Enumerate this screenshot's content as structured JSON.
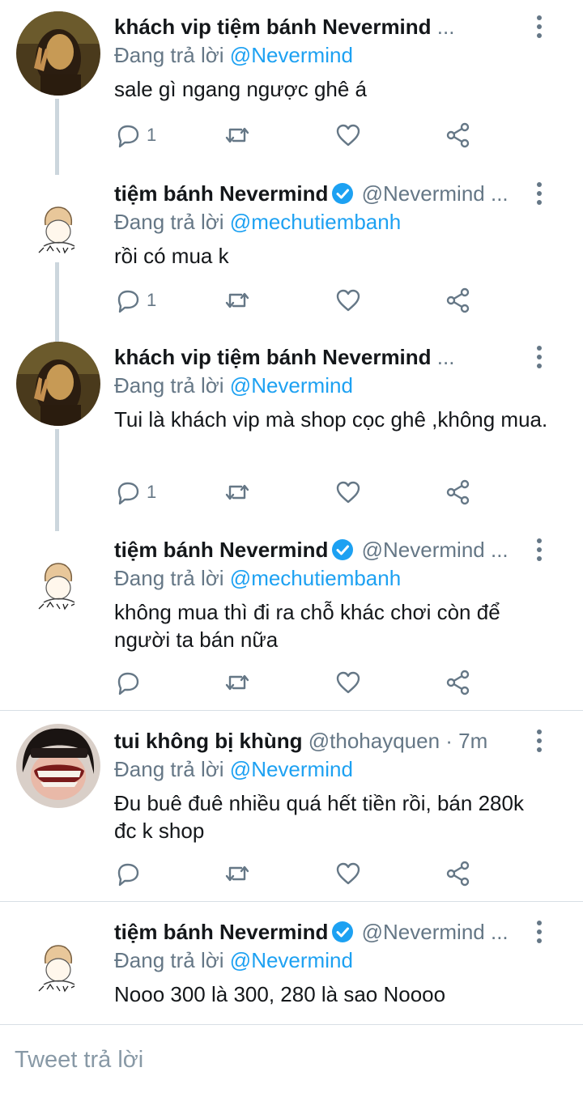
{
  "tweets": [
    {
      "avatar": "mona-lisa-avatar",
      "name": "khách vip tiệm bánh Nevermind",
      "verified": false,
      "handle": "",
      "ellipsis": "...",
      "time": "",
      "reply_prefix": "Đang trả lời",
      "reply_to": "@Nevermind",
      "text": "sale gì ngang ngược ghê á",
      "reply_count": "1"
    },
    {
      "avatar": "nevermind-sketch-avatar",
      "name": "tiệm bánh Nevermind",
      "verified": true,
      "handle": "@Nevermind ...",
      "ellipsis": "",
      "time": "",
      "reply_prefix": "Đang trả lời",
      "reply_to": "@mechutiembanh",
      "text": "rồi có mua k",
      "reply_count": "1"
    },
    {
      "avatar": "mona-lisa-avatar",
      "name": "khách vip tiệm bánh Nevermind",
      "verified": false,
      "handle": "",
      "ellipsis": "...",
      "time": "",
      "reply_prefix": "Đang trả lời",
      "reply_to": "@Nevermind",
      "text": "Tui là khách vip mà shop cọc ghê ,không mua.",
      "reply_count": "1"
    },
    {
      "avatar": "nevermind-sketch-avatar",
      "name": "tiệm bánh Nevermind",
      "verified": true,
      "handle": "@Nevermind ...",
      "ellipsis": "",
      "time": "",
      "reply_prefix": "Đang trả lời",
      "reply_to": "@mechutiembanh",
      "text": "không mua thì đi ra chỗ khác chơi còn để người ta bán nữa",
      "reply_count": ""
    },
    {
      "avatar": "grinning-face-avatar",
      "name": "tui không bị khùng",
      "verified": false,
      "handle": "@thohayquen · 7m",
      "ellipsis": "",
      "time": "",
      "reply_prefix": "Đang trả lời",
      "reply_to": "@Nevermind",
      "text": "Đu buê đuê nhiều quá hết tiền rồi, bán 280k đc k shop",
      "reply_count": ""
    },
    {
      "avatar": "nevermind-sketch-avatar",
      "name": "tiệm bánh Nevermind",
      "verified": true,
      "handle": "@Nevermind ...",
      "ellipsis": "",
      "time": "",
      "reply_prefix": "Đang trả lời",
      "reply_to": "@Nevermind",
      "text": "Nooo 300 là 300, 280 là sao Noooo",
      "reply_count": ""
    }
  ],
  "compose": {
    "placeholder": "Tweet trả lời"
  },
  "colors": {
    "accent": "#1da1f2",
    "muted": "#657786",
    "thread": "#ccd6dd",
    "text": "#14171a"
  },
  "icons": [
    "reply-icon",
    "retweet-icon",
    "like-icon",
    "share-icon",
    "more-options-icon",
    "verified-badge-icon"
  ]
}
